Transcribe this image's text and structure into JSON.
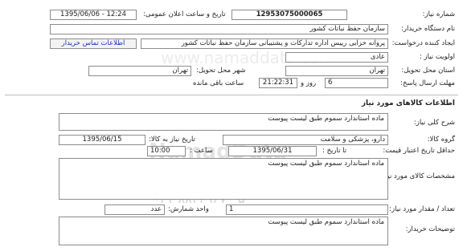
{
  "header": {
    "need_number_label": "شماره نیاز:",
    "need_number": "12953075000065",
    "announce_label": "تاریخ و ساعت اعلان عمومی:",
    "announce_value": "1395/06/06 - 12:24",
    "buyer_org_label": "نام دستگاه خریدار:",
    "buyer_org": "سازمان حفظ نباتات کشور",
    "creator_label": "ایجاد کننده درخواست:",
    "creator": "پروانه خزایی رییس اداره تدارکات و پشتیبانی سازمان حفظ نباتات کشور",
    "contact_link": "اطلاعات تماس خریدار",
    "priority_label": "اولویت نیاز :",
    "priority": "عادی",
    "province_label": "استان محل تحویل:",
    "province": "تهران",
    "city_label": "شهر محل تحویل:",
    "city": "تهران",
    "deadline_label": "مهلت ارسال پاسخ:",
    "days": "6",
    "days_unit": "روز و",
    "time_left": "21:22:31",
    "time_left_suffix": "ساعت باقی مانده"
  },
  "goods": {
    "section_title": "اطلاعات کالاهای مورد نیاز",
    "general_desc_label": "شرح کلی نیاز:",
    "general_desc": "ماده استاندارد سموم طبق لیست پیوست",
    "group_label": "گروه کالا:",
    "group": "دارو، پزشکی و سلامت",
    "need_date_label": "تاریخ نیاز به کالا:",
    "need_date": "1395/06/15",
    "min_price_date_label": "حداقل تاریخ اعتبار قیمت:",
    "until_date_label": "تا تاریخ :",
    "until_date": "1395/06/31",
    "time_label": "ساعت :",
    "time_value": "10:00",
    "goods_spec_label": "مشخصات کالای مورد نیاز:",
    "goods_spec": "ماده استاندارد سموم طبق لیست پیوست",
    "qty_label": "تعداد / مقدار مورد نیاز:",
    "qty": "1",
    "unit_label": "واحد شمارش:",
    "unit": "عدد",
    "buyer_notes_label": "توضیحات خریدار:",
    "buyer_notes": "ماده استاندارد سموم طبق لیست پیوست"
  },
  "watermark": {
    "line1": "پایگاه اطلاع رسانی مناقصه ومزایده",
    "line2": "۰۲۱-۸۸۳۴۹۶۷۰-۵",
    "line3": "NamadData",
    "line4": "www.namaddata.com"
  }
}
